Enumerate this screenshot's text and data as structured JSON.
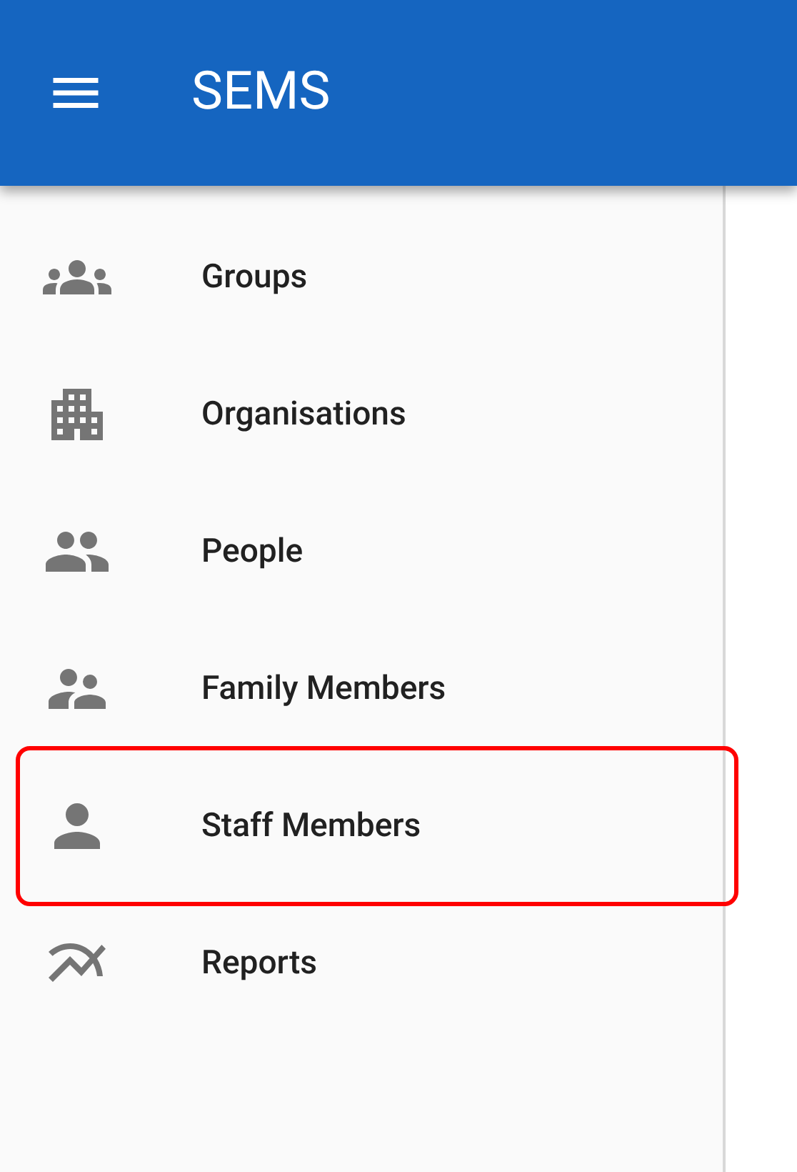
{
  "app_bar": {
    "title": "SEMS"
  },
  "nav_items": [
    {
      "kind": "groups",
      "label": "Groups",
      "highlighted": false
    },
    {
      "kind": "organisations",
      "label": "Organisations",
      "highlighted": false
    },
    {
      "kind": "people",
      "label": "People",
      "highlighted": false
    },
    {
      "kind": "family",
      "label": "Family Members",
      "highlighted": false
    },
    {
      "kind": "person",
      "label": "Staff Members",
      "highlighted": true
    },
    {
      "kind": "reports",
      "label": "Reports",
      "highlighted": false
    }
  ]
}
